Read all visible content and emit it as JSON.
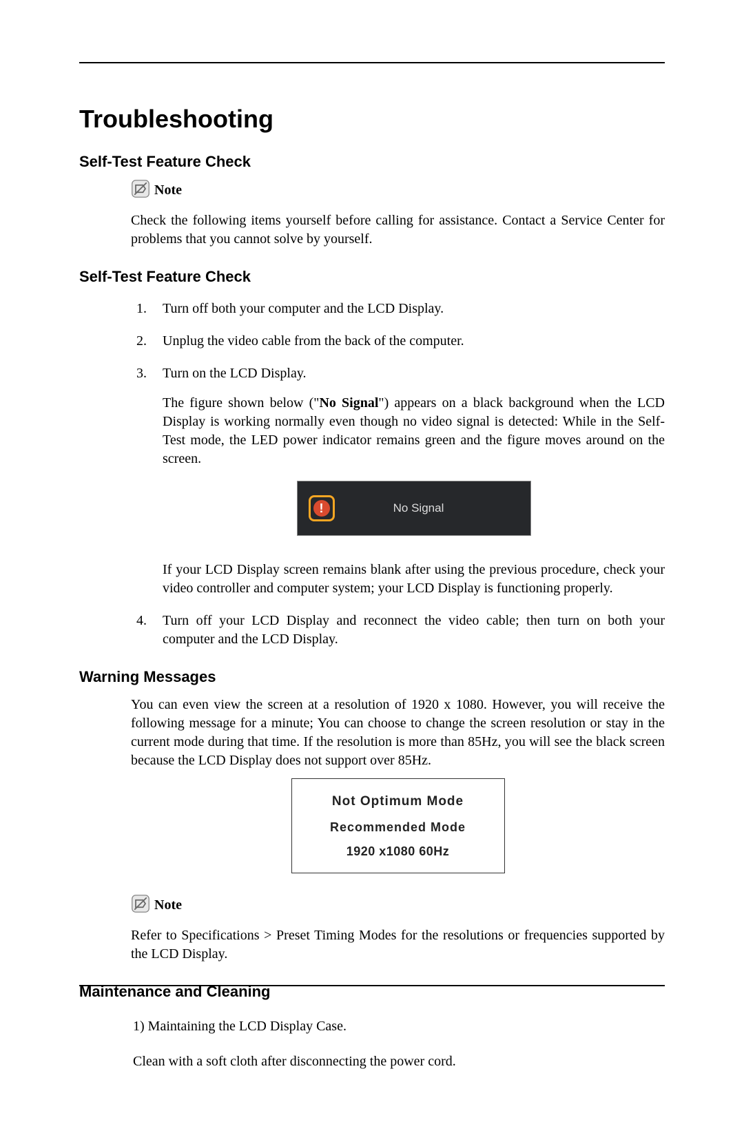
{
  "title": "Troubleshooting",
  "section1": {
    "heading": "Self-Test Feature Check",
    "noteLabel": "Note",
    "noteText": "Check the following items yourself before calling for assistance. Contact a Service Center for problems that you cannot solve by yourself."
  },
  "section2": {
    "heading": "Self-Test Feature Check",
    "items": [
      "Turn off both your computer and the LCD Display.",
      "Unplug the video cable from the back of the computer.",
      "Turn on the LCD Display."
    ],
    "figurePrefix": "The figure shown below (\"",
    "figureBold": "No Signal",
    "figureSuffix": "\") appears on a black background when the LCD Display is working normally even though no video signal is detected: While in the Self-Test mode, the LED power indicator remains green and the figure moves around on the screen.",
    "noSignalLabel": "No Signal",
    "afterFigure": "If your LCD Display screen remains blank after using the previous procedure, check your video controller and computer system; your LCD Display is functioning properly.",
    "item4": "Turn off your LCD Display and reconnect the video cable; then turn on both your computer and the LCD Display."
  },
  "section3": {
    "heading": "Warning Messages",
    "body": "You can even view the screen at a resolution of 1920 x 1080. However, you will receive the following message for a minute; You can choose to change the screen resolution or stay in the current mode during that time. If the resolution is more than 85Hz, you will see the black screen because the LCD Display does not support over 85Hz.",
    "box": {
      "line1": "Not Optimum Mode",
      "line2": "Recommended Mode",
      "line3": "1920 x1080  60Hz"
    },
    "noteLabel": "Note",
    "noteText": "Refer to Specifications > Preset Timing Modes for the resolutions or frequencies supported by the LCD Display."
  },
  "section4": {
    "heading": "Maintenance and Cleaning",
    "line1": "1) Maintaining the LCD Display Case.",
    "line2": "Clean with a soft cloth after disconnecting the power cord."
  }
}
